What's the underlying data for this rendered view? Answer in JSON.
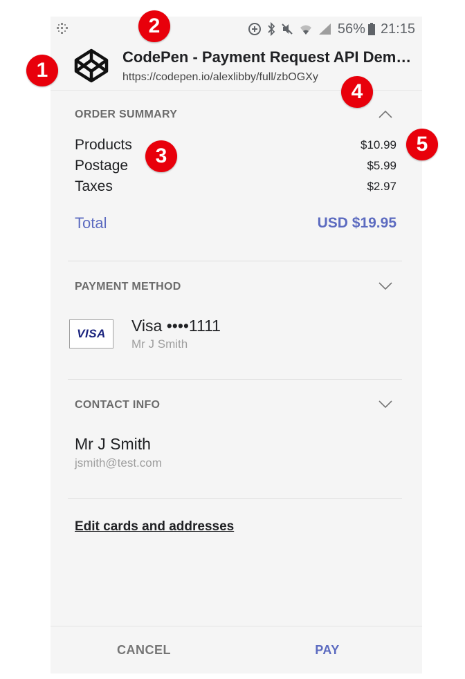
{
  "status_bar": {
    "battery": "56%",
    "time": "21:15"
  },
  "header": {
    "title": "CodePen - Payment Request API Dem…",
    "url": "https://codepen.io/alexlibby/full/zbOGXy"
  },
  "order_summary": {
    "label": "ORDER SUMMARY",
    "items": [
      {
        "label": "Products",
        "value": "$10.99"
      },
      {
        "label": "Postage",
        "value": "$5.99"
      },
      {
        "label": "Taxes",
        "value": "$2.97"
      }
    ],
    "total_label": "Total",
    "total_value": "USD $19.95"
  },
  "payment_method": {
    "label": "PAYMENT METHOD",
    "card_logo": "VISA",
    "card_line": "Visa  ••••1111",
    "card_holder": "Mr J Smith"
  },
  "contact_info": {
    "label": "CONTACT INFO",
    "name": "Mr J Smith",
    "email": "jsmith@test.com"
  },
  "edit_link": "Edit cards and addresses",
  "footer": {
    "cancel": "CANCEL",
    "pay": "PAY"
  },
  "callouts": [
    "1",
    "2",
    "3",
    "4",
    "5"
  ],
  "colors": {
    "accent": "#5c6bc0",
    "callout": "#e8000b",
    "panel_bg": "#f5f5f5"
  }
}
